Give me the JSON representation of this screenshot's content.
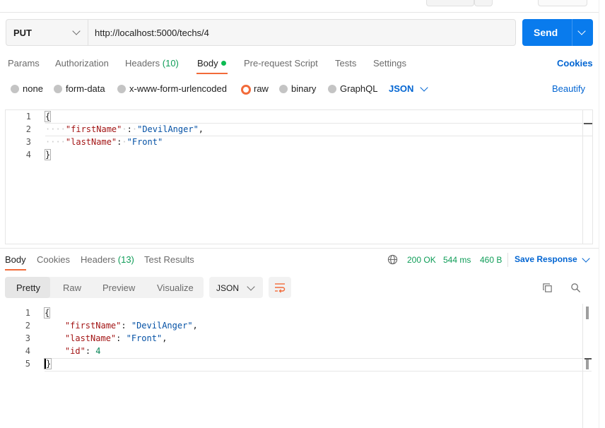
{
  "request": {
    "method": "PUT",
    "url": "http://localhost:5000/techs/4",
    "send_label": "Send"
  },
  "request_tabs": [
    {
      "label": "Params"
    },
    {
      "label": "Authorization"
    },
    {
      "label": "Headers",
      "count": "(10)"
    },
    {
      "label": "Body"
    },
    {
      "label": "Pre-request Script"
    },
    {
      "label": "Tests"
    },
    {
      "label": "Settings"
    }
  ],
  "cookies_link": "Cookies",
  "body_types": [
    "none",
    "form-data",
    "x-www-form-urlencoded",
    "raw",
    "binary",
    "GraphQL"
  ],
  "body_format": "JSON",
  "beautify_label": "Beautify",
  "request_body": {
    "line_numbers": [
      "1",
      "2",
      "3",
      "4"
    ],
    "open_brace": "{",
    "close_brace": "}",
    "key1": "\"firstName\"",
    "val1": "\"DevilAnger\"",
    "key2": "\"lastName\"",
    "val2": "\"Front\""
  },
  "response_tabs": [
    {
      "label": "Body"
    },
    {
      "label": "Cookies"
    },
    {
      "label": "Headers",
      "count": "(13)"
    },
    {
      "label": "Test Results"
    }
  ],
  "response_status": {
    "status": "200 OK",
    "time": "544 ms",
    "size": "460 B",
    "save_label": "Save Response"
  },
  "view_tabs": [
    "Pretty",
    "Raw",
    "Preview",
    "Visualize"
  ],
  "response_format": "JSON",
  "response_body": {
    "line_numbers": [
      "1",
      "2",
      "3",
      "4",
      "5"
    ],
    "open_brace": "{",
    "close_brace": "}",
    "key1": "\"firstName\"",
    "val1": "\"DevilAnger\"",
    "key2": "\"lastName\"",
    "val2": "\"Front\"",
    "key3": "\"id\"",
    "val3": "4"
  },
  "colors": {
    "accent": "#f26b3a",
    "send": "#097bed",
    "status_ok": "#0f9d58",
    "link": "#0265d2"
  },
  "icons": [
    "chevron-down-icon",
    "globe-icon",
    "wrap-lines-icon",
    "copy-icon",
    "search-icon"
  ]
}
